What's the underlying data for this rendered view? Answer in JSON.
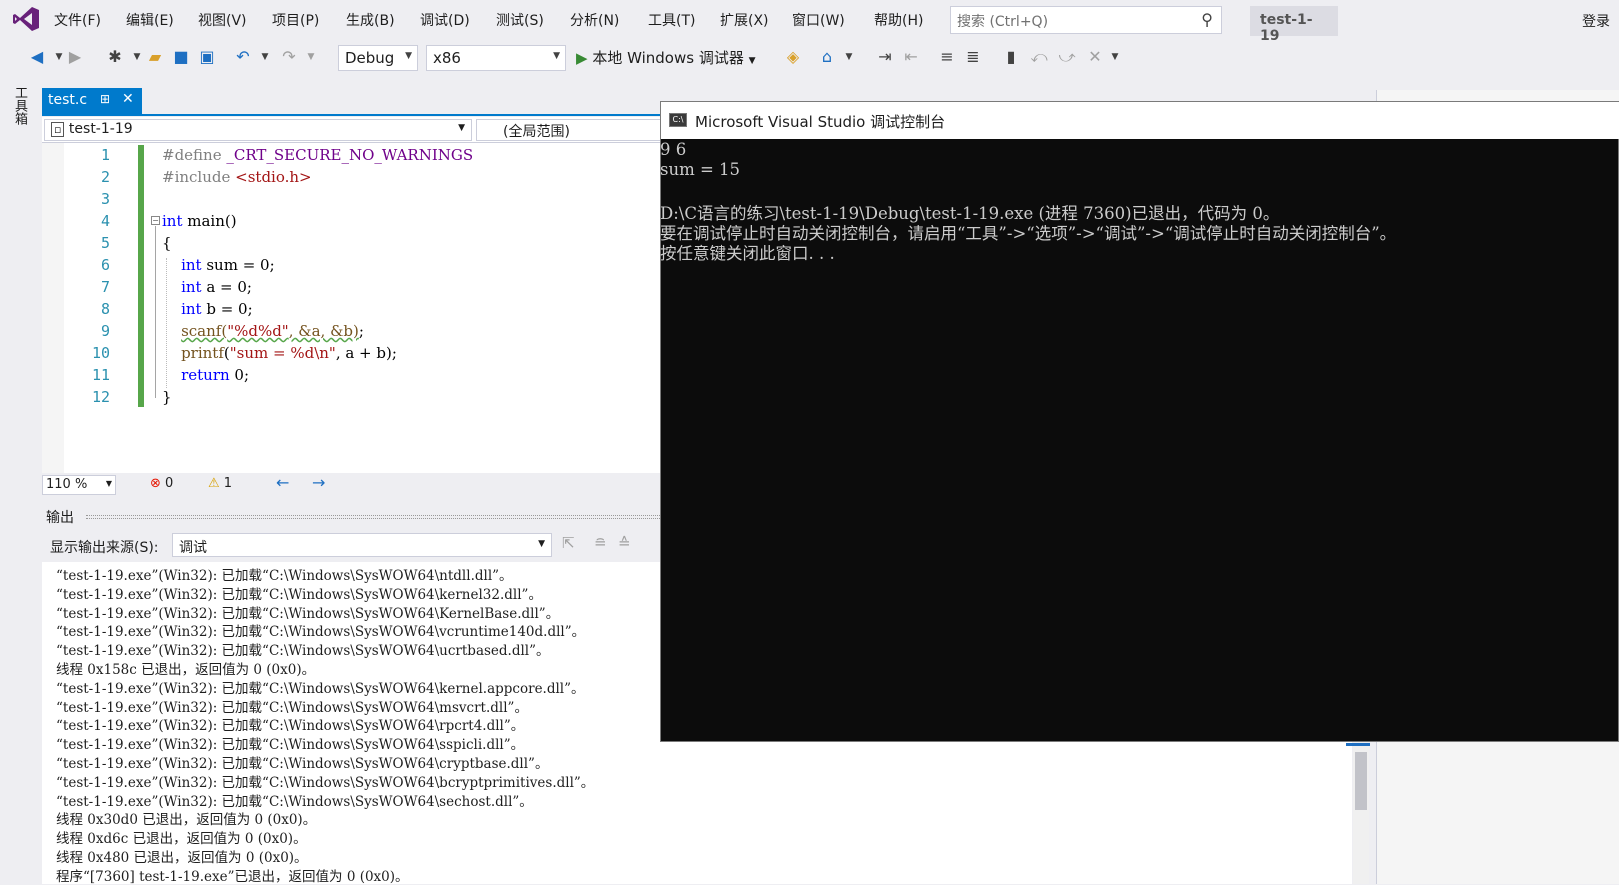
{
  "menu": [
    "文件(F)",
    "编辑(E)",
    "视图(V)",
    "项目(P)",
    "生成(B)",
    "调试(D)",
    "测试(S)",
    "分析(N)",
    "工具(T)",
    "扩展(X)",
    "窗口(W)",
    "帮助(H)"
  ],
  "search": {
    "placeholder": "搜索 (Ctrl+Q)"
  },
  "project_badge": "test-1-19",
  "login": "登录",
  "toolbar": {
    "config": "Debug",
    "platform": "x86",
    "run_label": "本地 Windows 调试器"
  },
  "sidebar": {
    "toolbox": "工具箱"
  },
  "editor": {
    "tab_name": "test.c",
    "nav_project": "test-1-19",
    "nav_scope": "(全局范围)",
    "line_numbers": [
      "1",
      "2",
      "3",
      "4",
      "5",
      "6",
      "7",
      "8",
      "9",
      "10",
      "11",
      "12"
    ],
    "zoom": "110 %",
    "errors": "0",
    "warnings": "1"
  },
  "output": {
    "title": "输出",
    "source_label": "显示输出来源(S):",
    "source_value": "调试",
    "lines": [
      "“test-1-19.exe”(Win32): 已加载“C:\\Windows\\SysWOW64\\ntdll.dll”。",
      "“test-1-19.exe”(Win32): 已加载“C:\\Windows\\SysWOW64\\kernel32.dll”。",
      "“test-1-19.exe”(Win32): 已加载“C:\\Windows\\SysWOW64\\KernelBase.dll”。",
      "“test-1-19.exe”(Win32): 已加载“C:\\Windows\\SysWOW64\\vcruntime140d.dll”。",
      "“test-1-19.exe”(Win32): 已加载“C:\\Windows\\SysWOW64\\ucrtbased.dll”。",
      "线程 0x158c 已退出，返回值为 0 (0x0)。",
      "“test-1-19.exe”(Win32): 已加载“C:\\Windows\\SysWOW64\\kernel.appcore.dll”。",
      "“test-1-19.exe”(Win32): 已加载“C:\\Windows\\SysWOW64\\msvcrt.dll”。",
      "“test-1-19.exe”(Win32): 已加载“C:\\Windows\\SysWOW64\\rpcrt4.dll”。",
      "“test-1-19.exe”(Win32): 已加载“C:\\Windows\\SysWOW64\\sspicli.dll”。",
      "“test-1-19.exe”(Win32): 已加载“C:\\Windows\\SysWOW64\\cryptbase.dll”。",
      "“test-1-19.exe”(Win32): 已加载“C:\\Windows\\SysWOW64\\bcryptprimitives.dll”。",
      "“test-1-19.exe”(Win32): 已加载“C:\\Windows\\SysWOW64\\sechost.dll”。",
      "线程 0x30d0 已退出，返回值为 0 (0x0)。",
      "线程 0xd6c 已退出，返回值为 0 (0x0)。",
      "线程 0x480 已退出，返回值为 0 (0x0)。",
      "程序“[7360] test-1-19.exe”已退出，返回值为 0 (0x0)。"
    ]
  },
  "console": {
    "title": "Microsoft Visual Studio 调试控制台",
    "lines": [
      "9 6",
      "sum = 15",
      "",
      "D:\\C语言的练习\\test-1-19\\Debug\\test-1-19.exe (进程 7360)已退出，代码为 0。",
      "要在调试停止时自动关闭控制台，请启用“工具”->“选项”->“调试”->“调试停止时自动关闭控制台”。",
      "按任意键关闭此窗口. . ."
    ]
  }
}
